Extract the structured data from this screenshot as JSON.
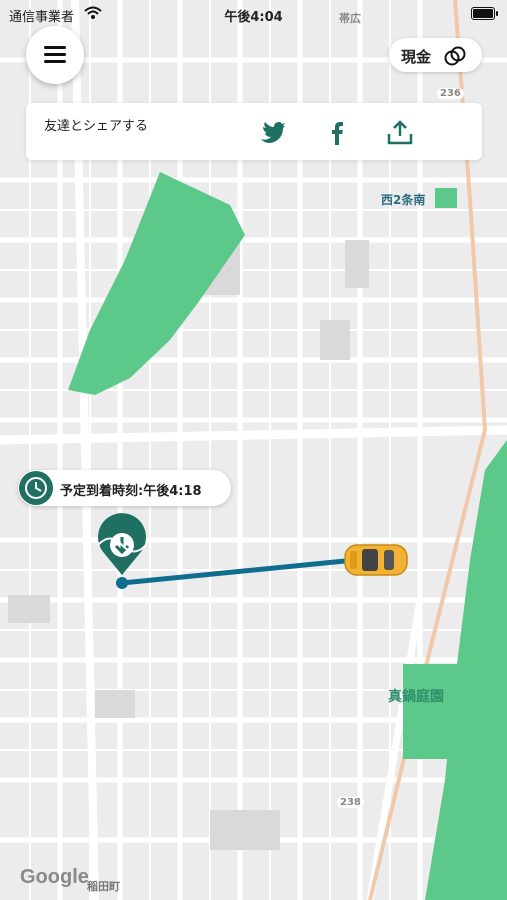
{
  "status_bar": {
    "carrier": "通信事業者",
    "time": "午後4:04"
  },
  "payment": {
    "label": "現金"
  },
  "share": {
    "label": "友達とシェアする",
    "buttons": [
      {
        "name": "twitter-button",
        "icon": "twitter-icon"
      },
      {
        "name": "facebook-button",
        "icon": "facebook-icon"
      },
      {
        "name": "share-button",
        "icon": "share-icon"
      }
    ]
  },
  "eta": {
    "text": "予定到着時刻:午後4:18"
  },
  "map": {
    "labels": [
      "帯広",
      "西2条南",
      "真鍋庭園",
      "236",
      "238",
      "稲田町"
    ],
    "attribution": "Google"
  },
  "colors": {
    "accent": "#1f6f62",
    "route": "#0f6e8f",
    "park": "#5cc98a",
    "taxi": "#f2b233"
  }
}
